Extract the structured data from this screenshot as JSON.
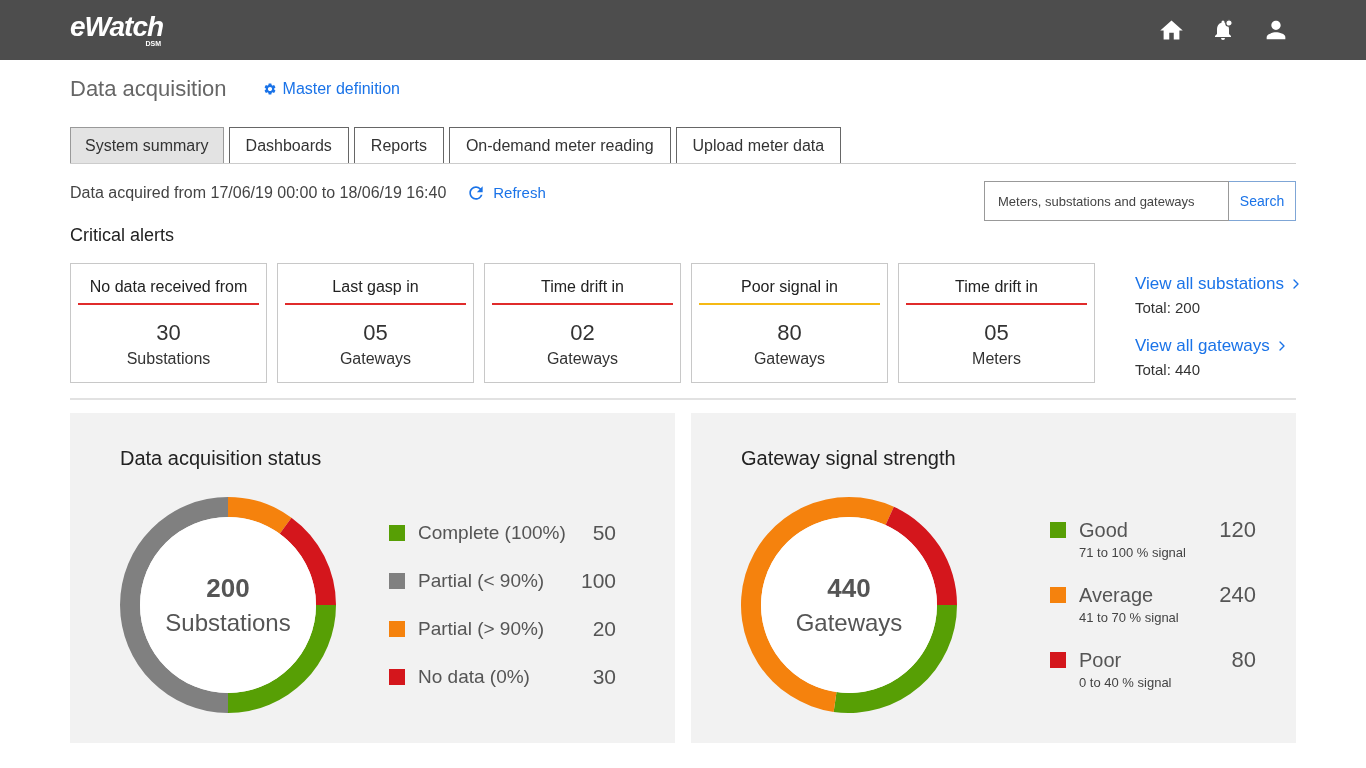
{
  "header": {
    "logo": "eWatch",
    "logo_sub": "DSM"
  },
  "page": {
    "title": "Data acquisition",
    "link": "Master definition"
  },
  "tabs": [
    {
      "label": "System summary",
      "selected": true
    },
    {
      "label": "Dashboards",
      "selected": false
    },
    {
      "label": "Reports",
      "selected": false
    },
    {
      "label": "On-demand meter reading",
      "selected": false
    },
    {
      "label": "Upload meter data",
      "selected": false
    }
  ],
  "acquisition": {
    "text": "Data acquired from 17/06/19 00:00 to 18/06/19 16:40",
    "refresh": "Refresh"
  },
  "search": {
    "placeholder": "Meters, substations and gateways",
    "button": "Search"
  },
  "critical_alerts": {
    "title": "Critical alerts",
    "cards": [
      {
        "title": "No data received from",
        "count": "30",
        "unit": "Substations",
        "color": "#e02b2b"
      },
      {
        "title": "Last gasp in",
        "count": "05",
        "unit": "Gateways",
        "color": "#e02b2b"
      },
      {
        "title": "Time drift in",
        "count": "02",
        "unit": "Gateways",
        "color": "#e02b2b"
      },
      {
        "title": "Poor signal in",
        "count": "80",
        "unit": "Gateways",
        "color": "#f5b914"
      },
      {
        "title": "Time drift in",
        "count": "05",
        "unit": "Meters",
        "color": "#e02b2b"
      }
    ],
    "links": [
      {
        "label": "View all substations",
        "total": "Total: 200"
      },
      {
        "label": "View all gateways",
        "total": "Total: 440"
      }
    ]
  },
  "panels": [
    {
      "title": "Data acquisition status",
      "center_value": "200",
      "center_label": "Substations",
      "legend": [
        {
          "value": "50"
        },
        {
          "value": "100"
        },
        {
          "value": "20"
        },
        {
          "value": "30"
        }
      ],
      "chart_data": {
        "type": "donut",
        "categories": [
          "Complete (100%)",
          "Partial (< 90%)",
          "Partial (> 90%)",
          "No data (0%)"
        ],
        "values": [
          25,
          50,
          10,
          15
        ],
        "colors": [
          "#579f05",
          "#808080",
          "#f5820d",
          "#d4161c"
        ]
      }
    },
    {
      "title": "Gateway signal strength",
      "center_value": "440",
      "center_label": "Gateways",
      "legend": [
        {
          "value": "120",
          "note": "71 to 100 % signal"
        },
        {
          "value": "240",
          "note": "41 to 70 % signal"
        },
        {
          "value": "80",
          "note": "0 to 40 % signal"
        }
      ],
      "chart_data": {
        "type": "donut",
        "categories": [
          "Good",
          "Average",
          "Poor"
        ],
        "values": [
          27.27,
          54.55,
          18.18
        ],
        "colors": [
          "#579f05",
          "#f5820d",
          "#d4161c"
        ]
      }
    }
  ]
}
